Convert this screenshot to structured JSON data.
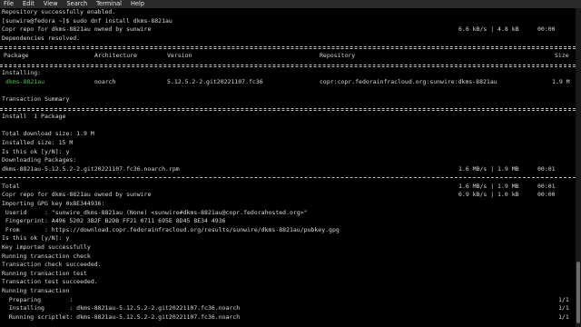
{
  "menu": [
    "File",
    "Edit",
    "View",
    "Search",
    "Terminal",
    "Help"
  ],
  "lines": {
    "l1": "Repository successfully enabled.",
    "l2": "[sunwire@fedora ~]$ sudo dnf install dkms-8821au",
    "l3": "Copr repo for dkms-8821au owned by sunwire",
    "l3_speed": "6.6 kB/s | 4.8 kB",
    "l3_time": "00:00",
    "l4": "Dependencies resolved.",
    "l_installing": "Installing:",
    "l_tx_summary": "Transaction Summary",
    "l_install_count": "Install  1 Package",
    "l_total_dl": "Total download size: 1.9 M",
    "l_installed_size": "Installed size: 15 M",
    "l_ok1": "Is this ok [y/N]: y",
    "l_dl_pkgs": "Downloading Packages:",
    "l_rpm": "dkms-8821au-5.12.5.2-2.git20221107.fc36.noarch.rpm",
    "l_rpm_speed": "1.6 MB/s | 1.9 MB",
    "l_rpm_time": "00:01",
    "l_total": "Total",
    "l_total_speed": "1.6 MB/s | 1.9 MB",
    "l_total_time": "00:01",
    "l_copr2": "Copr repo for dkms-8821au owned by sunwire",
    "l_copr2_speed": "6.9 kB/s | 1.0 kB",
    "l_copr2_time": "00:00",
    "l_gpg": "Importing GPG key 0x8E344936:",
    "l_userid": " Userid     : \"sunwire_dkms-8821au (None) <sunwire#dkms-8821au@copr.fedorahosted.org>\"",
    "l_fpr": " Fingerprint: A496 5202 3B2F B2D8 FF21 0711 695E 8D45 8E34 4936",
    "l_from": " From       : https://download.copr.fedorainfracloud.org/results/sunwire/dkms-8821au/pubkey.gpg",
    "l_ok2": "Is this ok [y/N]: y",
    "l_key_imported": "Key imported successfully",
    "l_run_check": "Running transaction check",
    "l_check_ok": "Transaction check succeeded.",
    "l_run_test": "Running transaction test",
    "l_test_ok": "Transaction test succeeded.",
    "l_run_tx": "Running transaction",
    "l_preparing": "  Preparing        :",
    "l_preparing_count": "1/1",
    "l_installing2": "  Installing       : dkms-8821au-5.12.5.2-2.git20221107.fc36.noarch",
    "l_installing2_count": "1/1",
    "l_scriptlet": "  Running scriptlet: dkms-8821au-5.12.5.2-2.git20221107.fc36.noarch",
    "l_scriptlet_count": "1/1"
  },
  "table": {
    "headers": {
      "package": "Package",
      "arch": "Architecture",
      "version": "Version",
      "repository": "Repository",
      "size": "Size"
    },
    "row": {
      "package": "dkms-8821au",
      "arch": "noarch",
      "version": "5.12.5.2-2.git20221107.fc36",
      "repository": "copr:copr.fedorainfracloud.org:sunwire:dkms-8821au",
      "size": "1.9 M"
    }
  }
}
